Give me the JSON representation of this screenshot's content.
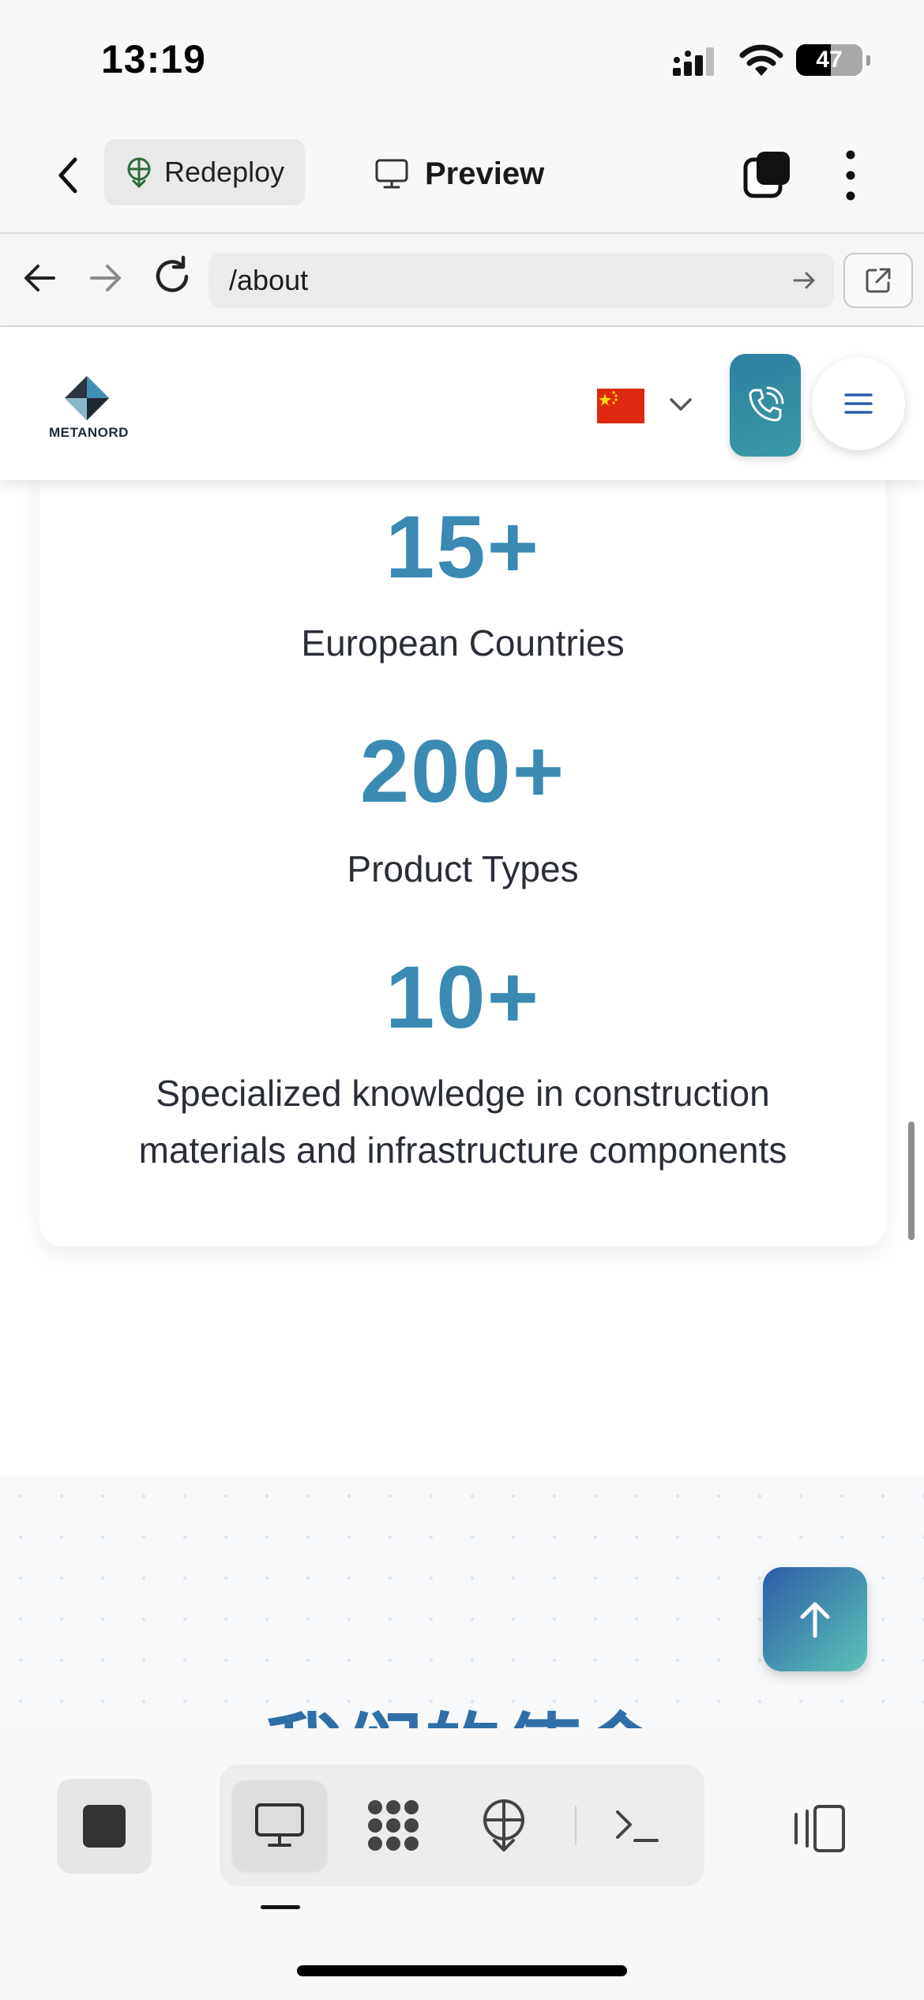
{
  "status_bar": {
    "time": "13:19",
    "battery": "47"
  },
  "app_header": {
    "redeploy_label": "Redeploy",
    "preview_label": "Preview"
  },
  "browser": {
    "url": "/about"
  },
  "site": {
    "logo": {
      "text_a": "METANORD",
      "text_b": ""
    },
    "language_flag": "china-flag",
    "colors": {
      "accent": "#3a8ab3",
      "flag_red": "#de2910"
    }
  },
  "stats": [
    {
      "number": "15+",
      "label": "European Countries"
    },
    {
      "number": "200+",
      "label": "Product Types"
    },
    {
      "number": "10+",
      "label_line1": "Specialized knowledge in construction",
      "label_line2": "materials and infrastructure components"
    }
  ],
  "section_heading": "我们的使命",
  "toolbar": {
    "items": [
      "stop-icon",
      "desktop-icon",
      "grid-icon",
      "deploy-icon",
      "terminal-icon",
      "layout-icon"
    ]
  }
}
